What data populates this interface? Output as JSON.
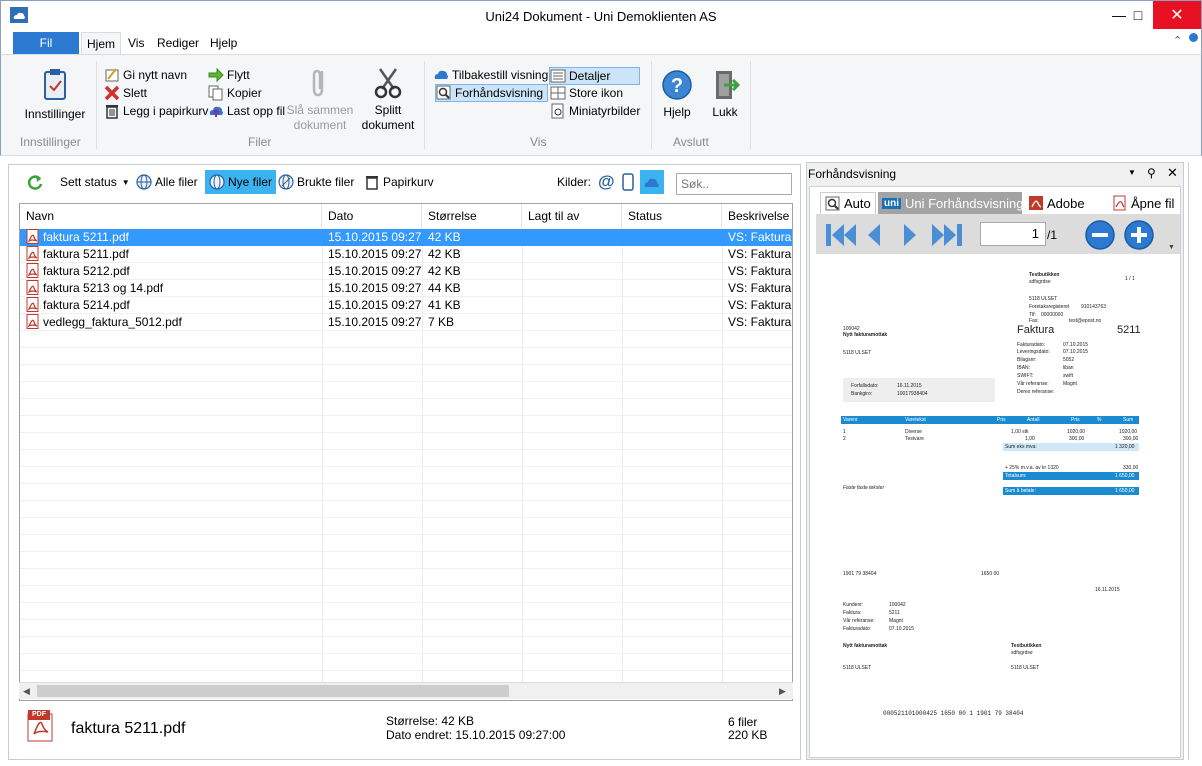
{
  "window": {
    "title": "Uni24 Dokument - Uni Demoklienten AS"
  },
  "menu": {
    "fil": "Fil",
    "hjem": "Hjem",
    "vis": "Vis",
    "rediger": "Rediger",
    "hjelp": "Hjelp"
  },
  "ribbon": {
    "innstillinger": "Innstillinger",
    "group_innstillinger": "Innstillinger",
    "gi_nytt_navn": "Gi nytt navn",
    "slett": "Slett",
    "legg_i_papirkurv": "Legg i papirkurv",
    "flytt": "Flytt",
    "kopier": "Kopier",
    "last_opp_fil": "Last opp fil",
    "sla_sammen_1": "Slå sammen",
    "sla_sammen_2": "dokument",
    "splitt_1": "Splitt",
    "splitt_2": "dokument",
    "group_filer": "Filer",
    "tilbakestill_visning": "Tilbakestill visning",
    "forhandsvisning": "Forhåndsvisning",
    "detaljer": "Detaljer",
    "store_ikon": "Store ikon",
    "miniatyrbilder": "Miniatyrbilder",
    "group_vis": "Vis",
    "hjelp": "Hjelp",
    "lukk": "Lukk",
    "group_avslutt": "Avslutt"
  },
  "toolbar": {
    "sett_status": "Sett status",
    "alle_filer": "Alle filer",
    "nye_filer": "Nye filer",
    "brukte_filer": "Brukte filer",
    "papirkurv": "Papirkurv",
    "kilder": "Kilder:",
    "search_placeholder": "Søk.."
  },
  "columns": [
    "Navn",
    "Dato",
    "Størrelse",
    "Lagt til av",
    "Status",
    "Beskrivelse"
  ],
  "files": [
    {
      "name": "faktura 5211.pdf",
      "date": "15.10.2015 09:27",
      "size": "42 KB",
      "added_by": "",
      "status": "",
      "desc": "VS: Faktura f"
    },
    {
      "name": "faktura 5211.pdf",
      "date": "15.10.2015 09:27",
      "size": "42 KB",
      "added_by": "",
      "status": "",
      "desc": "VS: Faktura f"
    },
    {
      "name": "faktura 5212.pdf",
      "date": "15.10.2015 09:27",
      "size": "42 KB",
      "added_by": "",
      "status": "",
      "desc": "VS: Faktura f"
    },
    {
      "name": "faktura 5213 og 14.pdf",
      "date": "15.10.2015 09:27",
      "size": "44 KB",
      "added_by": "",
      "status": "",
      "desc": "VS: Faktura f"
    },
    {
      "name": "faktura 5214.pdf",
      "date": "15.10.2015 09:27",
      "size": "41 KB",
      "added_by": "",
      "status": "",
      "desc": "VS: Faktura f"
    },
    {
      "name": "vedlegg_faktura_5012.pdf",
      "date": "15.10.2015 09:27",
      "size": "7 KB",
      "added_by": "",
      "status": "",
      "desc": "VS: Faktura f"
    }
  ],
  "status": {
    "pdf_badge": "PDF",
    "filename": "faktura 5211.pdf",
    "size_label": "Størrelse: 42 KB",
    "modified_label": "Dato endret: 15.10.2015 09:27:00",
    "file_count": "6 filer",
    "total_size": "220 KB"
  },
  "preview": {
    "title": "Forhåndsvisning",
    "tab_auto": "Auto",
    "tab_uni": "Uni Forhåndsvisning",
    "tab_uni_badge": "uni",
    "tab_adobe": "Adobe",
    "tab_apne": "Åpne fil",
    "page_num": "1",
    "page_total": "/1"
  },
  "invoice": {
    "company": "Testbutikken",
    "company_sub": "sdfsgrdse",
    "page": "1 / 1",
    "company_addr": "5118      ULSET",
    "foretak_label": "Foretaksregisteret",
    "foretak_val": "910143763",
    "tlf_label": "Tlf:",
    "tlf_val": "00000000",
    "fax_label": "Fax:",
    "email": "test@epost.no",
    "cust_no": "100042",
    "cust_name": "Nytt fakturamottak",
    "cust_addr": "5118      ULSET",
    "doc_title": "Faktura",
    "doc_no": "5211",
    "fakturadato_l": "Fakturadato:",
    "fakturadato_v": "07.10.2015",
    "leveringsdato_l": "Leveringsdato:",
    "leveringsdato_v": "07.10.2015",
    "bilagsnr_l": "Bilagsnr:",
    "bilagsnr_v": "5052",
    "iban_l": "IBAN:",
    "iban_v": "liban",
    "swift_l": "SWIFT:",
    "swift_v": "swift",
    "var_ref_l": "Vår referanse:",
    "var_ref_v": "Magnt",
    "deres_ref_l": "Deres referanse:",
    "forfall_l": "Forfallsdato:",
    "forfall_v": "16.11.2015",
    "bankgiro_l": "Bankgiro:",
    "bankgiro_v": "10017938404",
    "th_varenr": "Varenr",
    "th_varetekst": "Varetekst",
    "th_pris": "Pris",
    "th_antall": "Antall",
    "th_pris2": "Pris",
    "th_pct": "%",
    "th_sum": "Sum",
    "l1_no": "1",
    "l1_text": "Diverse",
    "l1_qty": "1,00  stk",
    "l1_price": "1020,00",
    "l1_sum": "1020,00",
    "l2_no": "2",
    "l2_text": "Testvare",
    "l2_qty": "1,00",
    "l2_price": "300,00",
    "l2_sum": "300,00",
    "sum_eks_l": "Sum eks mva:",
    "sum_eks_v": "1 320,00",
    "mva_l": "+ 25% m.v.a. av kr 1320",
    "mva_v": "330,00",
    "totalsum_l": "Totalsum:",
    "totalsum_v": "1 650,00",
    "betale_l": "Sum å betale:",
    "betale_v": "1 650,00",
    "fotnote": "Faste faste tekster",
    "giro_account": "1901 79 38404",
    "giro_amount": "1650  00",
    "giro_date": "16.11.2015",
    "kunde_l": "Kundenr:",
    "kunde_v": "100042",
    "fakt_l": "Faktura:",
    "fakt_v": "5211",
    "vref_l": "Vår referanse:",
    "vref_v": "Magnt",
    "fdato_l": "Fakturadato:",
    "fdato_v": "07.10.2015",
    "pay_name": "Nytt fakturamottak",
    "pay_addr": "5118      ULSET",
    "rec_name": "Testbutikken",
    "rec_sub": "sdfsgrdse",
    "rec_addr": "5118      ULSET",
    "kid": "000521101000425      1650  00    1      1901  79  38404"
  }
}
